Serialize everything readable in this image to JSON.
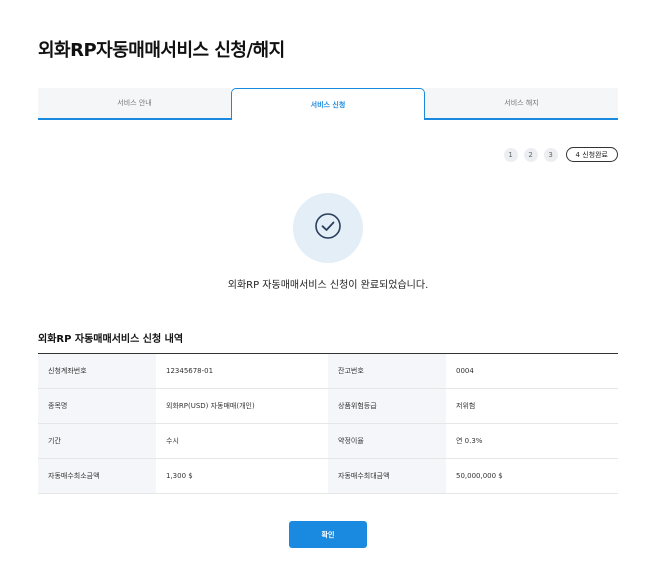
{
  "page": {
    "title": "외화RP자동매매서비스 신청/해지"
  },
  "tabs": [
    {
      "label": "서비스 안내",
      "active": false
    },
    {
      "label": "서비스 신청",
      "active": true
    },
    {
      "label": "서비스 해지",
      "active": false
    }
  ],
  "steps": {
    "items": [
      "1",
      "2",
      "3"
    ],
    "current_label": "4 신청완료"
  },
  "completion": {
    "icon": "check-circle-icon",
    "message": "외화RP 자동매매서비스 신청이 완료되었습니다."
  },
  "details": {
    "title": "외화RP 자동매매서비스 신청 내역",
    "rows": [
      {
        "label1": "신청계좌번호",
        "value1": "12345678-01",
        "label2": "잔고번호",
        "value2": "0004"
      },
      {
        "label1": "종목명",
        "value1": "외화RP(USD) 자동매매(개인)",
        "label2": "상품위험등급",
        "value2": "저위험"
      },
      {
        "label1": "기간",
        "value1": "수시",
        "label2": "약정이율",
        "value2": "연 0.3%"
      },
      {
        "label1": "자동매수최소금액",
        "value1": "1,300 $",
        "label2": "자동매수최대금액",
        "value2": "50,000,000 $"
      }
    ]
  },
  "actions": {
    "confirm_label": "확인"
  },
  "colors": {
    "accent": "#1a8ae0",
    "icon_bg": "#e3eef7",
    "header_cell_bg": "#f4f6f9",
    "icon_stroke": "#2b3e5c"
  }
}
